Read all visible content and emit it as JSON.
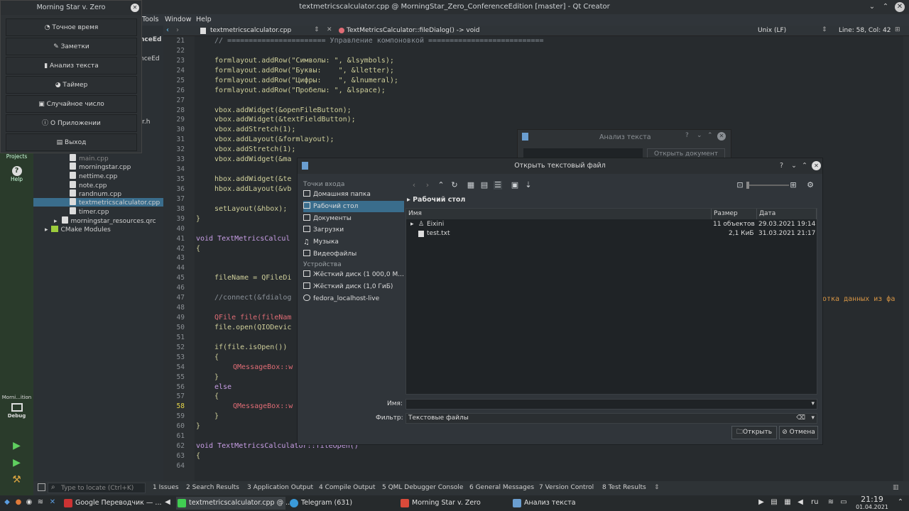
{
  "qt": {
    "title": "textmetricscalculator.cpp @ MorningStar_Zero_ConferenceEdition [master] - Qt Creator",
    "menu": [
      "Tools",
      "Window",
      "Help"
    ],
    "editor_toolbar": {
      "file": "textmetricscalculator.cpp",
      "symbol": "TextMetricsCalculator::fileDialog() -> void",
      "encoding": "Unix (LF)",
      "position": "Line: 58, Col: 42"
    },
    "modes": [
      "Projects",
      "Help"
    ],
    "kit": {
      "name": "Morni...ition",
      "config": "Debug"
    },
    "sidebar_partial": [
      "nceEd",
      "nceEd",
      "r.h"
    ],
    "tree": [
      "main.cpp",
      "morningstar.cpp",
      "nettime.cpp",
      "note.cpp",
      "randnum.cpp",
      "textmetricscalculator.cpp",
      "timer.cpp",
      "morningstar_resources.qrc",
      "CMake Modules"
    ],
    "lines": [
      {
        "n": "21",
        "t": "// ======================= Управление компоновкой ==========================="
      },
      {
        "n": "22",
        "t": ""
      },
      {
        "n": "23",
        "t": "formlayout.addRow(\"Символы: \", &lsymbols);"
      },
      {
        "n": "24",
        "t": "formlayout.addRow(\"Буквы:    \", &lletter);"
      },
      {
        "n": "25",
        "t": "formlayout.addRow(\"Цифры:    \", &lnumeral);"
      },
      {
        "n": "26",
        "t": "formlayout.addRow(\"Пробелы: \", &lspace);"
      },
      {
        "n": "27",
        "t": ""
      },
      {
        "n": "28",
        "t": "vbox.addWidget(&openFileButton);"
      },
      {
        "n": "29",
        "t": "vbox.addWidget(&textFieldButton);"
      },
      {
        "n": "30",
        "t": "vbox.addStretch(1);"
      },
      {
        "n": "31",
        "t": "vbox.addLayout(&formlayout);"
      },
      {
        "n": "32",
        "t": "vbox.addStretch(1);"
      },
      {
        "n": "33",
        "t": "vbox.addWidget(&ma"
      },
      {
        "n": "34",
        "t": ""
      },
      {
        "n": "35",
        "t": "hbox.addWidget(&te"
      },
      {
        "n": "36",
        "t": "hbox.addLayout(&vb"
      },
      {
        "n": "37",
        "t": ""
      },
      {
        "n": "38",
        "t": "setLayout(&hbox);"
      },
      {
        "n": "39",
        "t": "}"
      },
      {
        "n": "40",
        "t": ""
      },
      {
        "n": "41",
        "t": "void TextMetricsCalcul"
      },
      {
        "n": "42",
        "t": "{"
      },
      {
        "n": "43",
        "t": ""
      },
      {
        "n": "44",
        "t": ""
      },
      {
        "n": "45",
        "t": "fileName = QFileDi"
      },
      {
        "n": "46",
        "t": ""
      },
      {
        "n": "47",
        "t": "//connect(&fdialog"
      },
      {
        "n": "48",
        "t": ""
      },
      {
        "n": "49",
        "t": "QFile file(fileNam"
      },
      {
        "n": "50",
        "t": "file.open(QIODevic"
      },
      {
        "n": "51",
        "t": ""
      },
      {
        "n": "52",
        "t": "if(file.isOpen())"
      },
      {
        "n": "53",
        "t": "{"
      },
      {
        "n": "54",
        "t": "QMessageBox::w"
      },
      {
        "n": "55",
        "t": "}"
      },
      {
        "n": "56",
        "t": "else"
      },
      {
        "n": "57",
        "t": "{"
      },
      {
        "n": "58",
        "t": "QMessageBox::w"
      },
      {
        "n": "59",
        "t": "}"
      },
      {
        "n": "60",
        "t": "}"
      },
      {
        "n": "61",
        "t": ""
      },
      {
        "n": "62",
        "t": "void TextMetricsCalculator::fileOpen()"
      },
      {
        "n": "63",
        "t": "{"
      },
      {
        "n": "64",
        "t": ""
      }
    ],
    "right_overflow": "отка данных из фа",
    "locator_placeholder": "Type to locate (Ctrl+K)",
    "output_panes": [
      "1 Issues",
      "2 Search Results",
      "3 Application Output",
      "4 Compile Output",
      "5 QML Debugger Console",
      "6 General Messages",
      "7 Version Control",
      "8 Test Results"
    ]
  },
  "morning_star": {
    "title": "Morning Star v. Zero",
    "buttons": [
      "Точное время",
      "Заметки",
      "Анализ текста",
      "Таймер",
      "Случайное число",
      "О Приложении",
      "Выход"
    ]
  },
  "analyze": {
    "title": "Анализ текста",
    "open_button": "Открыть документ"
  },
  "dialog": {
    "title": "Открыть текстовый файл",
    "places_group": "Точки входа",
    "places": [
      "Домашняя папка",
      "Рабочий стол",
      "Документы",
      "Загрузки",
      "Музыка",
      "Видеофайлы"
    ],
    "devices_group": "Устройства",
    "devices": [
      "Жёсткий диск (1 000,0 М...",
      "Жёсткий диск (1,0 ГиБ)",
      "fedora_localhost-live"
    ],
    "breadcrumb": "Рабочий стол",
    "columns": [
      "Имя",
      "Размер",
      "Дата"
    ],
    "rows": [
      {
        "name": "Eixini",
        "size": "11 объектов",
        "date": "29.03.2021 19:14"
      },
      {
        "name": "test.txt",
        "size": "2,1 КиБ",
        "date": "31.03.2021 21:17"
      }
    ],
    "name_label": "Имя:",
    "name_value": "",
    "filter_label": "Фильтр:",
    "filter_value": "Текстовые файлы",
    "open_button": "Открыть",
    "cancel_button": "Отмена"
  },
  "taskbar": {
    "tasks": [
      "Google Переводчик — ...",
      "textmetricscalculator.cpp @ ...",
      "Telegram (631)",
      "Morning Star v. Zero",
      "Анализ текста"
    ],
    "lang": "ru",
    "time": "21:19",
    "date": "01.04.2021"
  },
  "colors": {
    "accent": "#3a6d8c",
    "mode_bar": "#2a3b2b",
    "keyword": "#c89ee6",
    "string": "#d69545",
    "class": "#e06c75"
  }
}
